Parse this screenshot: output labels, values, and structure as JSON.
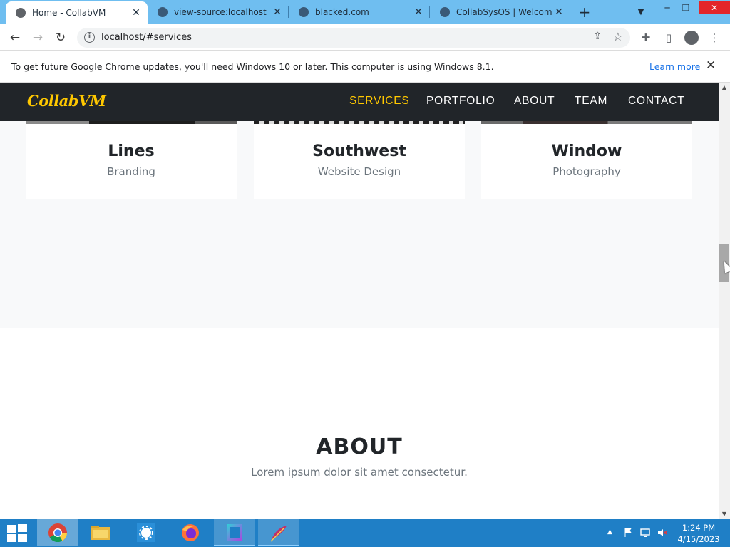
{
  "browser": {
    "tabs": [
      {
        "title": "Home - CollabVM",
        "active": true
      },
      {
        "title": "view-source:localhost",
        "active": false
      },
      {
        "title": "blacked.com",
        "active": false
      },
      {
        "title": "CollabSysOS | Welcome",
        "active": false
      }
    ],
    "new_tab_symbol": "+",
    "url": "localhost/#services",
    "infobar": {
      "message": "To get future Google Chrome updates, you'll need Windows 10 or later. This computer is using Windows 8.1.",
      "link": "Learn more"
    },
    "icons": {
      "back": "arrow-left-icon",
      "forward": "arrow-right-icon",
      "reload": "reload-icon",
      "info": "info-icon",
      "share": "share-icon",
      "bookmark": "star-icon",
      "extensions": "puzzle-icon",
      "sidepanel": "sidepanel-icon",
      "profile": "profile-icon",
      "menu": "kebab-menu-icon"
    }
  },
  "site": {
    "brand": "CollabVM",
    "nav": [
      {
        "label": "SERVICES",
        "active": true
      },
      {
        "label": "PORTFOLIO",
        "active": false
      },
      {
        "label": "ABOUT",
        "active": false
      },
      {
        "label": "TEAM",
        "active": false
      },
      {
        "label": "CONTACT",
        "active": false
      }
    ],
    "portfolio_items": [
      {
        "title": "Lines",
        "subtitle": "Branding"
      },
      {
        "title": "Southwest",
        "subtitle": "Website Design"
      },
      {
        "title": "Window",
        "subtitle": "Photography"
      }
    ],
    "about": {
      "heading": "ABOUT",
      "subheading": "Lorem ipsum dolor sit amet consectetur."
    },
    "colors": {
      "accent": "#ffc800",
      "nav_bg": "#212529",
      "section_bg": "#f8f9fa"
    }
  },
  "taskbar": {
    "apps": [
      "chrome-icon",
      "file-explorer-icon",
      "weather-app-icon",
      "firefox-icon",
      "app-square-icon",
      "feather-app-icon"
    ],
    "clock_time": "1:24 PM",
    "clock_date": "4/15/2023"
  }
}
